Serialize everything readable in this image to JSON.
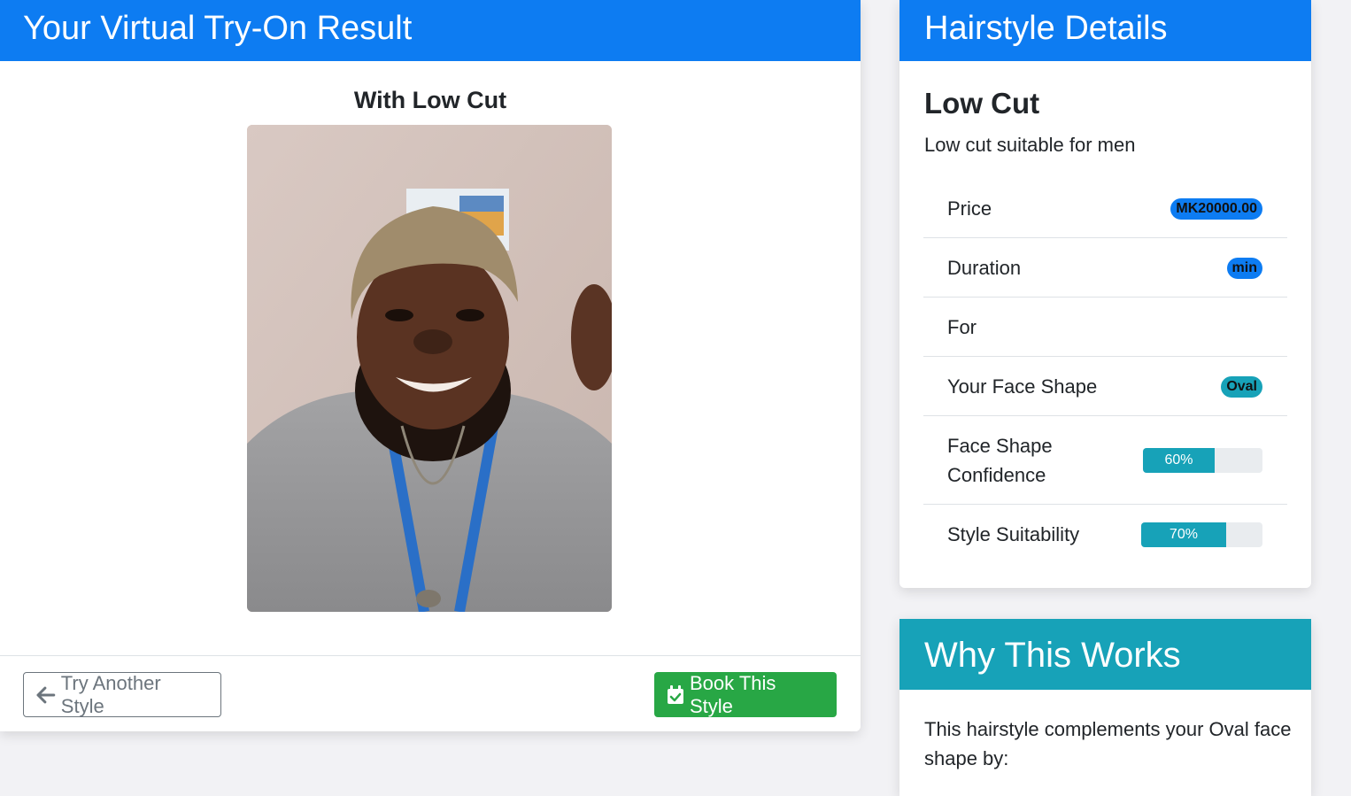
{
  "result": {
    "header": "Your Virtual Try-On Result",
    "caption": "With Low Cut",
    "photo_alt": "Try-on photo",
    "try_another_label": "Try Another Style",
    "book_label": "Book This Style"
  },
  "details": {
    "header": "Hairstyle Details",
    "name": "Low Cut",
    "description": "Low cut suitable for men",
    "rows": [
      {
        "label": "Price",
        "badge": "MK20000.00"
      },
      {
        "label": "Duration",
        "badge": "min"
      },
      {
        "label": "For",
        "badge": ""
      },
      {
        "label": "Your Face Shape",
        "badge": "Oval"
      },
      {
        "label": "Face Shape Confidence",
        "progress_text": "60%",
        "progress_value": 0.6
      },
      {
        "label": "Style Suitability",
        "progress_text": "70%",
        "progress_value": 0.7
      }
    ]
  },
  "why": {
    "header": "Why This Works",
    "text": "This hairstyle complements your Oval face shape by:"
  },
  "colors": {
    "primary": "#0d7cf2",
    "info": "#17a2b8",
    "success": "#28a745",
    "secondary": "#6c757d"
  },
  "icons": {
    "back": "arrow-left-icon",
    "book": "calendar-check-icon"
  }
}
